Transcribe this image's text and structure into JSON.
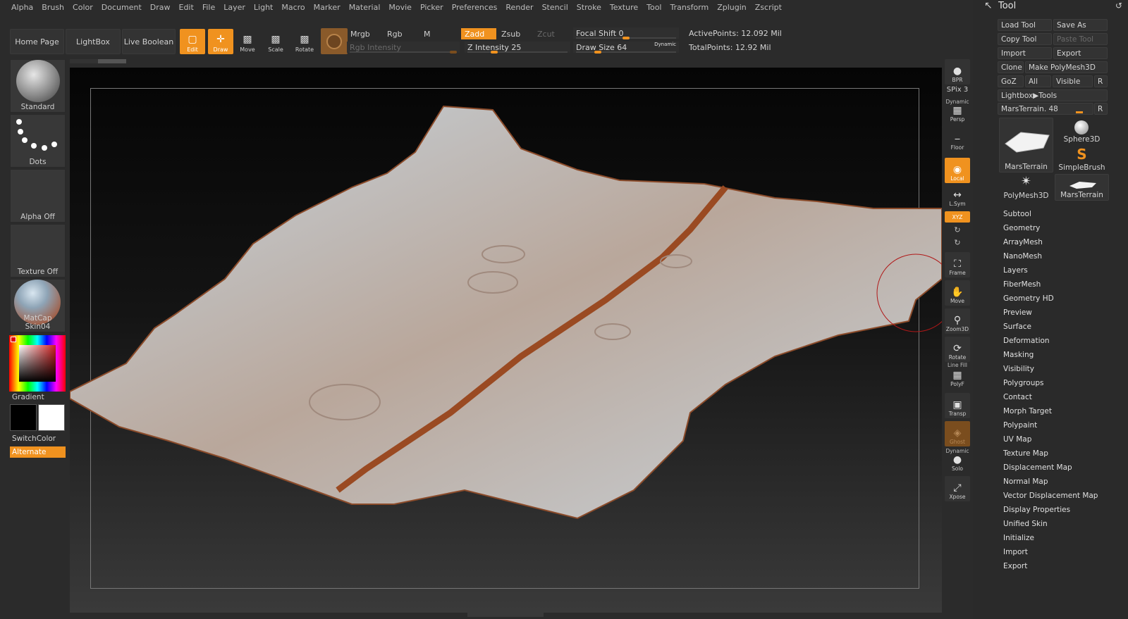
{
  "menubar": {
    "items": [
      "Alpha",
      "Brush",
      "Color",
      "Document",
      "Draw",
      "Edit",
      "File",
      "Layer",
      "Light",
      "Macro",
      "Marker",
      "Material",
      "Movie",
      "Picker",
      "Preferences",
      "Render",
      "Stencil",
      "Stroke",
      "Texture",
      "Tool",
      "Transform",
      "Zplugin",
      "Zscript"
    ]
  },
  "toolbar": {
    "home_page": "Home Page",
    "lightbox": "LightBox",
    "live_boolean": "Live Boolean",
    "edit": "Edit",
    "draw": "Draw",
    "move": "Move",
    "scale": "Scale",
    "rotate": "Rotate",
    "mrgb": "Mrgb",
    "rgb": "Rgb",
    "m": "M",
    "rgb_intensity": "Rgb Intensity",
    "zadd": "Zadd",
    "zsub": "Zsub",
    "zcut": "Zcut",
    "z_intensity": "Z Intensity 25",
    "focal_shift": "Focal Shift 0",
    "draw_size": "Draw Size 64",
    "dynamic": "Dynamic",
    "active_points": "ActivePoints: 12.092 Mil",
    "total_points": "TotalPoints: 12.92 Mil",
    "z_intensity_level": 0.25,
    "focal_shift_level": 0.5,
    "draw_size_level": 0.2
  },
  "left_shelf": {
    "brush": "Standard",
    "stroke": "Dots",
    "alpha": "Alpha Off",
    "texture": "Texture Off",
    "material": "MatCap Skin04",
    "gradient": "Gradient",
    "switch_color": "SwitchColor",
    "alternate": "Alternate"
  },
  "right_shelf": {
    "bpr": "BPR",
    "spix": "SPix 3",
    "dynamic": "Dynamic",
    "persp": "Persp",
    "floor": "Floor",
    "local": "Local",
    "lsym": "L.Sym",
    "xyz": "XYZ",
    "frame": "Frame",
    "move": "Move",
    "zoom3d": "Zoom3D",
    "rotate": "Rotate",
    "line_fill": "Line Fill",
    "polyf": "PolyF",
    "transp": "Transp",
    "ghost": "Ghost",
    "dynamic2": "Dynamic",
    "solo": "Solo",
    "xpose": "Xpose"
  },
  "tool_panel": {
    "title": "Tool",
    "load_tool": "Load Tool",
    "save_as": "Save As",
    "copy_tool": "Copy Tool",
    "paste_tool": "Paste Tool",
    "import": "Import",
    "export": "Export",
    "clone": "Clone",
    "make_polymesh": "Make PolyMesh3D",
    "goz": "GoZ",
    "all": "All",
    "visible": "Visible",
    "r": "R",
    "lightbox_tools": "Lightbox▶Tools",
    "current_tool": "MarsTerrain. 48",
    "thumbs": [
      "MarsTerrain",
      "Sphere3D",
      "SimpleBrush",
      "PolyMesh3D",
      "MarsTerrain"
    ],
    "subpalettes": [
      "Subtool",
      "Geometry",
      "ArrayMesh",
      "NanoMesh",
      "Layers",
      "FiberMesh",
      "Geometry HD",
      "Preview",
      "Surface",
      "Deformation",
      "Masking",
      "Visibility",
      "Polygroups",
      "Contact",
      "Morph Target",
      "Polypaint",
      "UV Map",
      "Texture Map",
      "Displacement Map",
      "Normal Map",
      "Vector Displacement Map",
      "Display Properties",
      "Unified Skin",
      "Initialize",
      "Import",
      "Export"
    ]
  }
}
